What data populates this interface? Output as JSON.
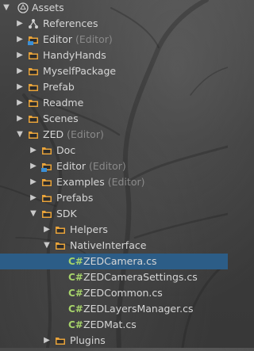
{
  "root": {
    "label": "Assets",
    "icon": "unity-logo-icon"
  },
  "items": [
    {
      "label": "References",
      "suffix": "",
      "icon": "references-icon",
      "expanded": false,
      "depth": 1
    },
    {
      "label": "Editor",
      "suffix": "(Editor)",
      "icon": "editor-folder-icon",
      "expanded": false,
      "depth": 1
    },
    {
      "label": "HandyHands",
      "suffix": "",
      "icon": "folder-icon",
      "expanded": false,
      "depth": 1
    },
    {
      "label": "MyselfPackage",
      "suffix": "",
      "icon": "folder-icon",
      "expanded": false,
      "depth": 1
    },
    {
      "label": "Prefab",
      "suffix": "",
      "icon": "folder-icon",
      "expanded": false,
      "depth": 1
    },
    {
      "label": "Readme",
      "suffix": "",
      "icon": "folder-icon",
      "expanded": false,
      "depth": 1
    },
    {
      "label": "Scenes",
      "suffix": "",
      "icon": "folder-icon",
      "expanded": false,
      "depth": 1
    },
    {
      "label": "ZED",
      "suffix": "(Editor)",
      "icon": "folder-icon",
      "expanded": true,
      "depth": 1
    },
    {
      "label": "Doc",
      "suffix": "",
      "icon": "folder-icon",
      "expanded": false,
      "depth": 2
    },
    {
      "label": "Editor",
      "suffix": "(Editor)",
      "icon": "editor-folder-icon",
      "expanded": false,
      "depth": 2
    },
    {
      "label": "Examples",
      "suffix": "(Editor)",
      "icon": "folder-icon",
      "expanded": false,
      "depth": 2
    },
    {
      "label": "Prefabs",
      "suffix": "",
      "icon": "folder-icon",
      "expanded": false,
      "depth": 2
    },
    {
      "label": "SDK",
      "suffix": "",
      "icon": "folder-icon",
      "expanded": true,
      "depth": 2
    },
    {
      "label": "Helpers",
      "suffix": "",
      "icon": "folder-icon",
      "expanded": false,
      "depth": 3
    },
    {
      "label": "NativeInterface",
      "suffix": "",
      "icon": "folder-icon",
      "expanded": true,
      "depth": 3
    },
    {
      "label": "ZEDCamera.cs",
      "suffix": "",
      "icon": "csharp-file-icon",
      "file": true,
      "selected": true,
      "depth": 4
    },
    {
      "label": "ZEDCameraSettings.cs",
      "suffix": "",
      "icon": "csharp-file-icon",
      "file": true,
      "depth": 4
    },
    {
      "label": "ZEDCommon.cs",
      "suffix": "",
      "icon": "csharp-file-icon",
      "file": true,
      "depth": 4
    },
    {
      "label": "ZEDLayersManager.cs",
      "suffix": "",
      "icon": "csharp-file-icon",
      "file": true,
      "depth": 4
    },
    {
      "label": "ZEDMat.cs",
      "suffix": "",
      "icon": "csharp-file-icon",
      "file": true,
      "depth": 4
    },
    {
      "label": "Plugins",
      "suffix": "",
      "icon": "folder-icon",
      "expanded": false,
      "depth": 3
    }
  ],
  "csharp_badge": "C#",
  "colors": {
    "folder": "#e8a33a",
    "selected_row": "#2c5d87",
    "suffix": "#8a8a8a",
    "csharp": "#a6d36a"
  }
}
